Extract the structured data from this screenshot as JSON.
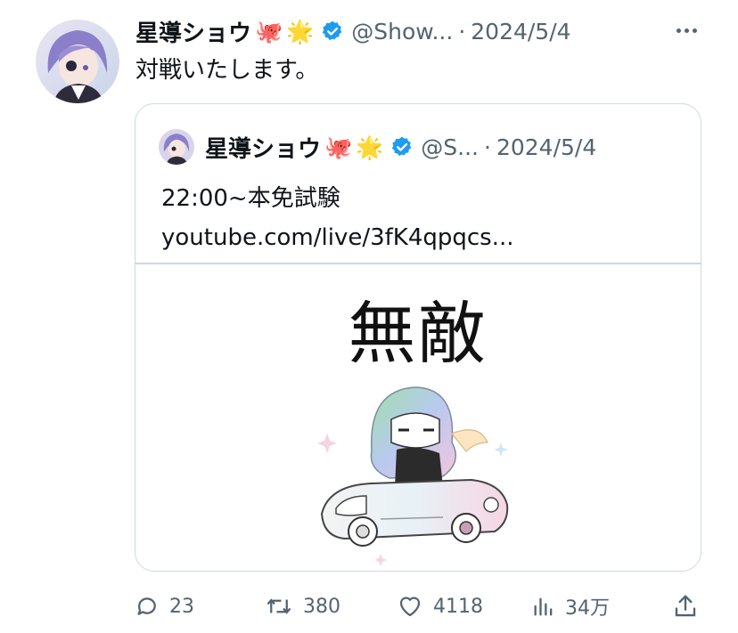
{
  "post": {
    "author_name": "星導ショウ",
    "emoji_1": "🐙",
    "emoji_2": "🌟",
    "handle": "@Show...",
    "separator": "·",
    "date": "2024/5/4",
    "text": "対戦いたします。"
  },
  "quoted": {
    "author_name": "星導ショウ",
    "emoji_1": "🐙",
    "emoji_2": "🌟",
    "handle": "@S...",
    "separator": "·",
    "date": "2024/5/4",
    "line1": "22:00~本免試験",
    "link": "youtube.com/live/3fK4qpqcs...",
    "image_title": "無敵"
  },
  "actions": {
    "replies": "23",
    "reposts": "380",
    "likes": "4118",
    "views": "34万"
  },
  "colors": {
    "text": "#0f1419",
    "secondary": "#536471",
    "border": "#cfd9de",
    "verified": "#1d9bf0"
  },
  "icons": [
    "reply-icon",
    "repost-icon",
    "like-icon",
    "views-icon",
    "share-icon",
    "verified-icon",
    "more-icon"
  ]
}
